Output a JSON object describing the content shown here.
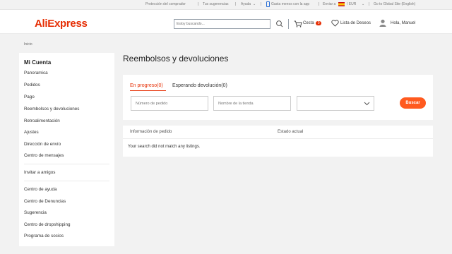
{
  "topbar": {
    "buyer_protection": "Protección del comprador",
    "suggestions": "Tus sugerencias",
    "help": "Ayuda",
    "app_promo": "Gasta menos con la app",
    "ship_to": "Enviar a",
    "currency": "/ EUR",
    "global_site": "Go to Global Site (English)"
  },
  "header": {
    "logo": "AliExpress",
    "search_placeholder": "Estoy buscando...",
    "cart_label": "Cesta",
    "cart_count": "0",
    "wishlist_label": "Lista de Deseos",
    "greeting": "Hola, Manuel"
  },
  "breadcrumb": {
    "home": "Inicio"
  },
  "sidebar": {
    "title": "Mi Cuenta",
    "items": [
      "Panoramica",
      "Pedidos",
      "Pago",
      "Reembolsos y devoluciones",
      "Retroalimentación",
      "Ajustes",
      "Dirección de envío",
      "Centro de mensajes",
      "Invitar a amigos",
      "Centro de ayuda",
      "Centro de Denuncias",
      "Sugerencia",
      "Centro de dropshipping",
      "Programa de socios"
    ]
  },
  "main": {
    "title": "Reembolsos y devoluciones",
    "tabs": [
      "En progreso(0)",
      "Esperando devolución(0)"
    ],
    "order_number_placeholder": "Número de pedido",
    "store_name_placeholder": "Nombre de la tienda",
    "status_select_value": "",
    "search_button": "Buscar",
    "columns": [
      "Información de pedido",
      "Estado actual"
    ],
    "empty_message": "Your search did not match any listings."
  },
  "colors": {
    "brand": "#e62e04",
    "button": "#ff5a1f",
    "background": "#f2f2f2"
  }
}
